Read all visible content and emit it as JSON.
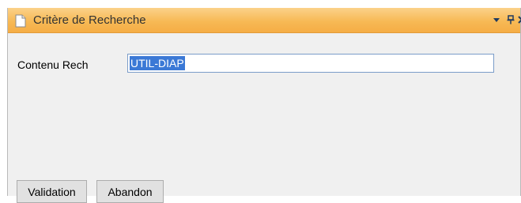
{
  "window": {
    "title": "Critère de Recherche",
    "title_icon": "document-icon",
    "controls": [
      "dropdown-icon",
      "pin-icon",
      "close-icon"
    ],
    "title_bar_color": "#f7b955"
  },
  "form": {
    "content_label": "Contenu Rech",
    "content_value": "UTIL-DIAP"
  },
  "buttons": {
    "validation_label": "Validation",
    "abandon_label": "Abandon"
  }
}
